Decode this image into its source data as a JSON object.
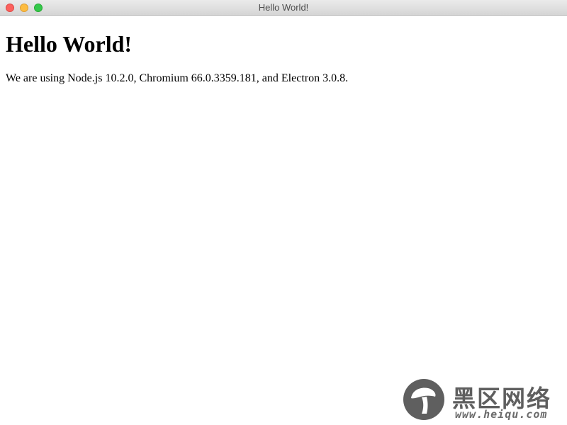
{
  "window": {
    "title": "Hello World!"
  },
  "page": {
    "heading": "Hello World!",
    "body_text": "We are using Node.js 10.2.0, Chromium 66.0.3359.181, and Electron 3.0.8."
  },
  "watermark": {
    "brand": "黑区网络",
    "url": "www.heiqu.com"
  },
  "colors": {
    "close": "#fc615d",
    "minimize": "#fdbc40",
    "zoom": "#34c84a",
    "watermark": "#5f5f5f"
  }
}
